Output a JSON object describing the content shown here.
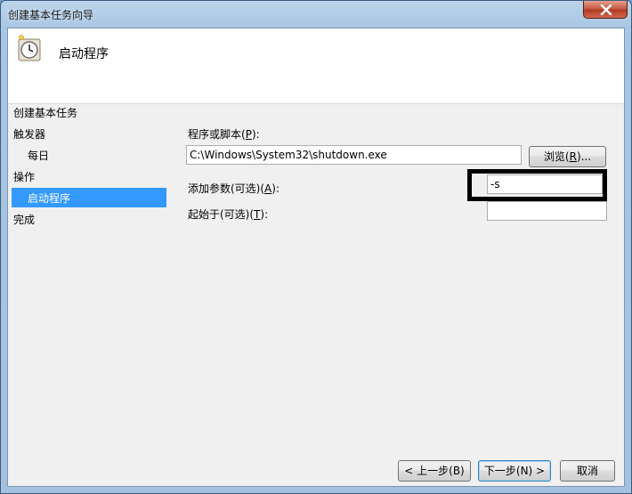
{
  "window": {
    "title": "创建基本任务向导",
    "close_label": "×"
  },
  "header": {
    "title": "启动程序",
    "icon": "clock-icon"
  },
  "nav": {
    "section_title": "创建基本任务",
    "items": [
      {
        "label": "触发器"
      },
      {
        "label": "每日"
      },
      {
        "label": "操作"
      },
      {
        "label": "启动程序",
        "selected": true
      },
      {
        "label": "完成"
      }
    ]
  },
  "form": {
    "program_label_pre": "程序或脚本(",
    "program_label_key": "P",
    "program_label_post": "):",
    "program_value": "C:\\Windows\\System32\\shutdown.exe",
    "browse_pre": "浏览(",
    "browse_key": "R",
    "browse_post": ")...",
    "args_label_pre": "添加参数(可选)(",
    "args_label_key": "A",
    "args_label_post": "):",
    "args_value": "-s",
    "startin_label_pre": "起始于(可选)(",
    "startin_label_key": "T",
    "startin_label_post": "):",
    "startin_value": ""
  },
  "buttons": {
    "back": "< 上一步(B)",
    "next": "下一步(N) >",
    "cancel": "取消"
  },
  "colors": {
    "selection": "#3399ff",
    "highlight_box": "#000000"
  }
}
